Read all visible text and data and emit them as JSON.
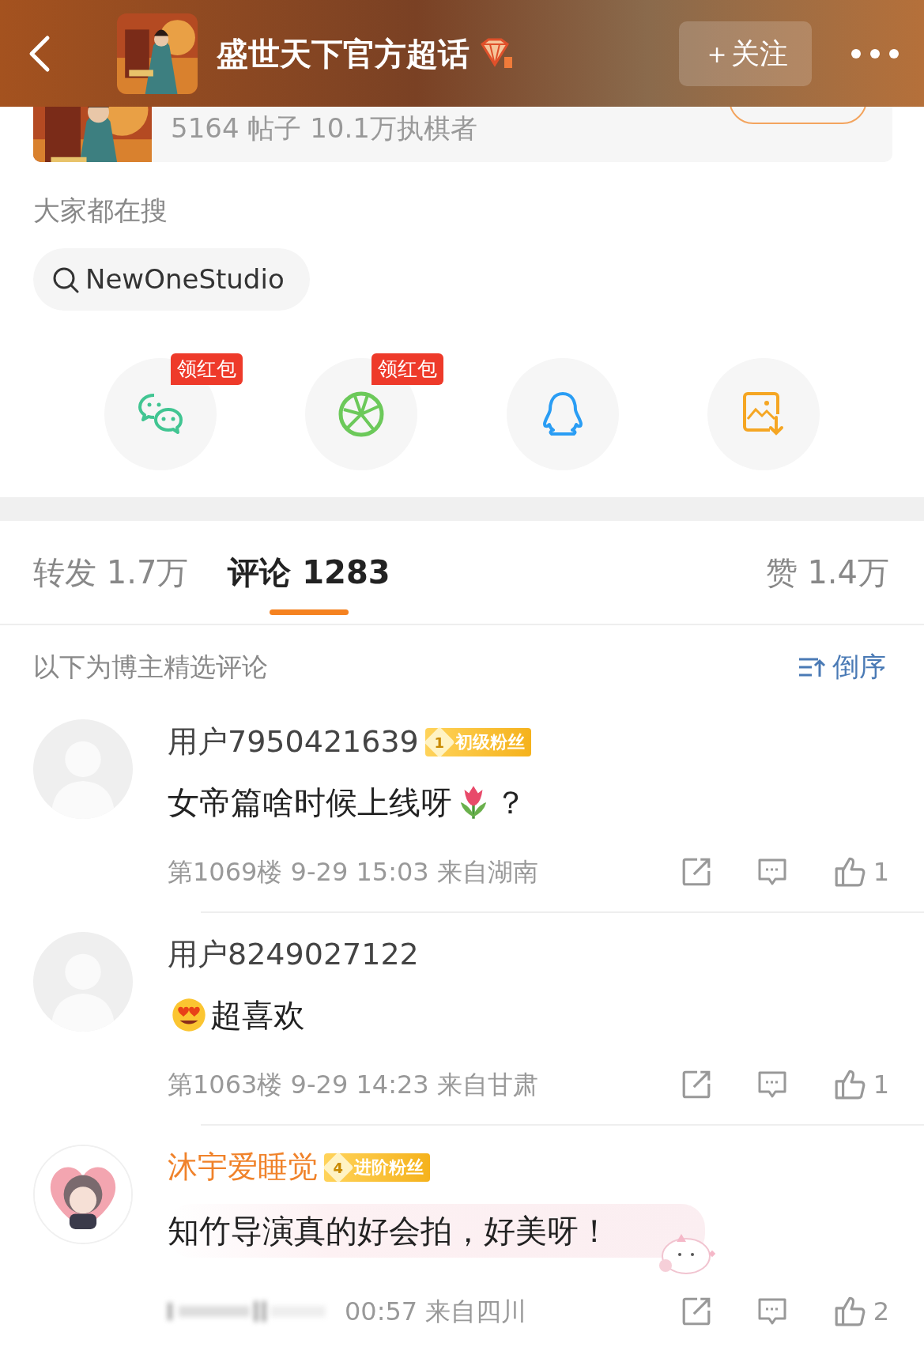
{
  "header": {
    "title": "盛世天下官方超话",
    "follow_button": "＋关注"
  },
  "topic_card": {
    "stats": "5164 帖子 10.1万执棋者"
  },
  "trending": {
    "heading": "大家都在搜",
    "queries": [
      "NewOneStudio"
    ]
  },
  "share_targets": [
    {
      "kind": "wechat",
      "badge": "领红包"
    },
    {
      "kind": "moments",
      "badge": "领红包"
    },
    {
      "kind": "qq"
    },
    {
      "kind": "save-image"
    }
  ],
  "tabs": [
    {
      "label": "转发 1.7万",
      "selected": false
    },
    {
      "label": "评论 1283",
      "selected": true
    },
    {
      "label": "赞 1.4万",
      "selected": false
    }
  ],
  "comments_header": {
    "note": "以下为博主精选评论",
    "sort_button": "倒序"
  },
  "comments": [
    {
      "avatar": {
        "kind": "default"
      },
      "user": "用户7950421639",
      "highlighted": false,
      "fan_badge": {
        "rank": "1",
        "label": "初级粉丝"
      },
      "segments": [
        {
          "kind": "text",
          "text": "女帝篇啥时候上线呀"
        },
        {
          "kind": "tulip"
        },
        {
          "kind": "text",
          "text": "？"
        }
      ],
      "bubble": false,
      "meta_blurred": false,
      "meta": "第1069楼 9-29 15:03 来自湖南",
      "likes": "1"
    },
    {
      "avatar": {
        "kind": "default"
      },
      "user": "用户8249027122",
      "highlighted": false,
      "segments": [
        {
          "kind": "heart-eyes"
        },
        {
          "kind": "text",
          "text": "超喜欢"
        }
      ],
      "bubble": false,
      "meta_blurred": false,
      "meta": "第1063楼 9-29 14:23 来自甘肃",
      "likes": "1"
    },
    {
      "avatar": {
        "kind": "illustrated"
      },
      "user": "沐宇爱睡觉",
      "highlighted": true,
      "fan_badge": {
        "rank": "4",
        "label": "进阶粉丝"
      },
      "segments": [
        {
          "kind": "text",
          "text": "知竹导演真的好会拍，好美呀！"
        }
      ],
      "bubble": true,
      "meta_blurred": true,
      "meta": "00:57 来自四川",
      "likes": "2"
    }
  ]
}
